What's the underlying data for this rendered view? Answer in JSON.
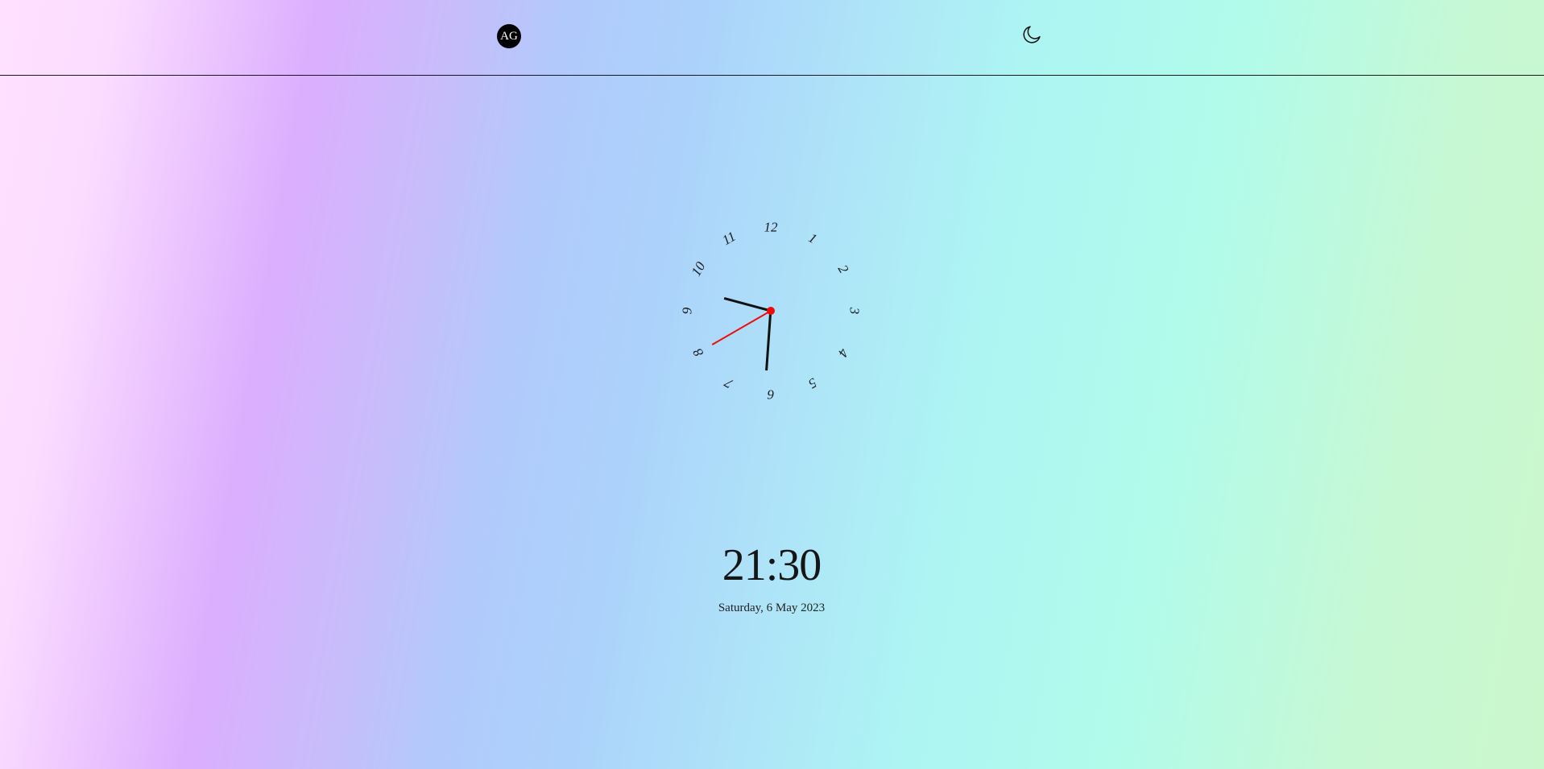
{
  "header": {
    "avatar_initials": "AG",
    "theme_toggle_icon": "moon-icon"
  },
  "clock": {
    "numbers": [
      "12",
      "1",
      "2",
      "3",
      "4",
      "5",
      "6",
      "7",
      "8",
      "9",
      "10",
      "11"
    ],
    "hour": 21,
    "minute": 30,
    "second": 40,
    "hand_color": "#111111",
    "second_hand_color": "#f00a0a"
  },
  "digital": {
    "time": "21:30",
    "date": "Saturday, 6 May 2023"
  }
}
